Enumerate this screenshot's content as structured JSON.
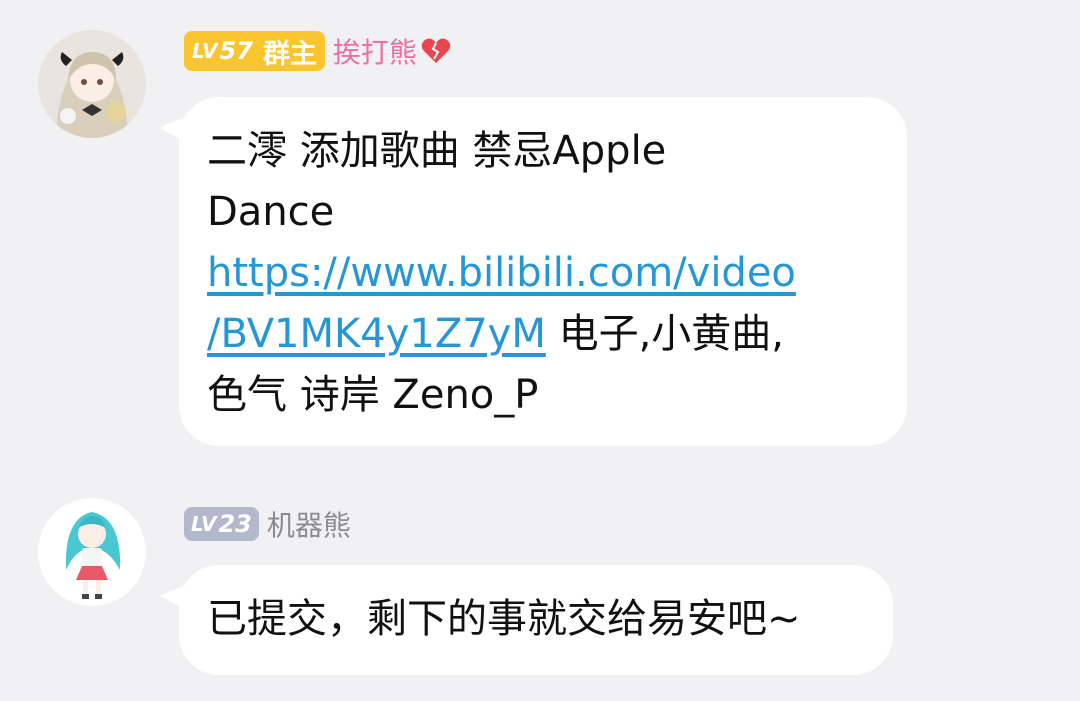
{
  "messages": [
    {
      "level_tag": "LV",
      "level_num": "57",
      "role": "群主",
      "nickname": "挨打熊",
      "nickname_emoji": "broken-heart-icon",
      "nickname_color": "#ef6fa0",
      "level_color": "#fbc530",
      "lines": {
        "l1": "二澪 添加歌曲 禁忌Apple",
        "l2": "Dance",
        "link1": "https://www.bilibili.com/video",
        "link2": "/BV1MK4y1Z7yM",
        "l4_rest": " 电子,小黄曲,",
        "l5": "色气 诗岸 Zeno_P"
      }
    },
    {
      "level_tag": "LV",
      "level_num": "23",
      "nickname": "机器熊",
      "nickname_color": "#8b8b94",
      "level_color": "#b4b8cc",
      "text": "已提交，剩下的事就交给易安吧~"
    }
  ]
}
